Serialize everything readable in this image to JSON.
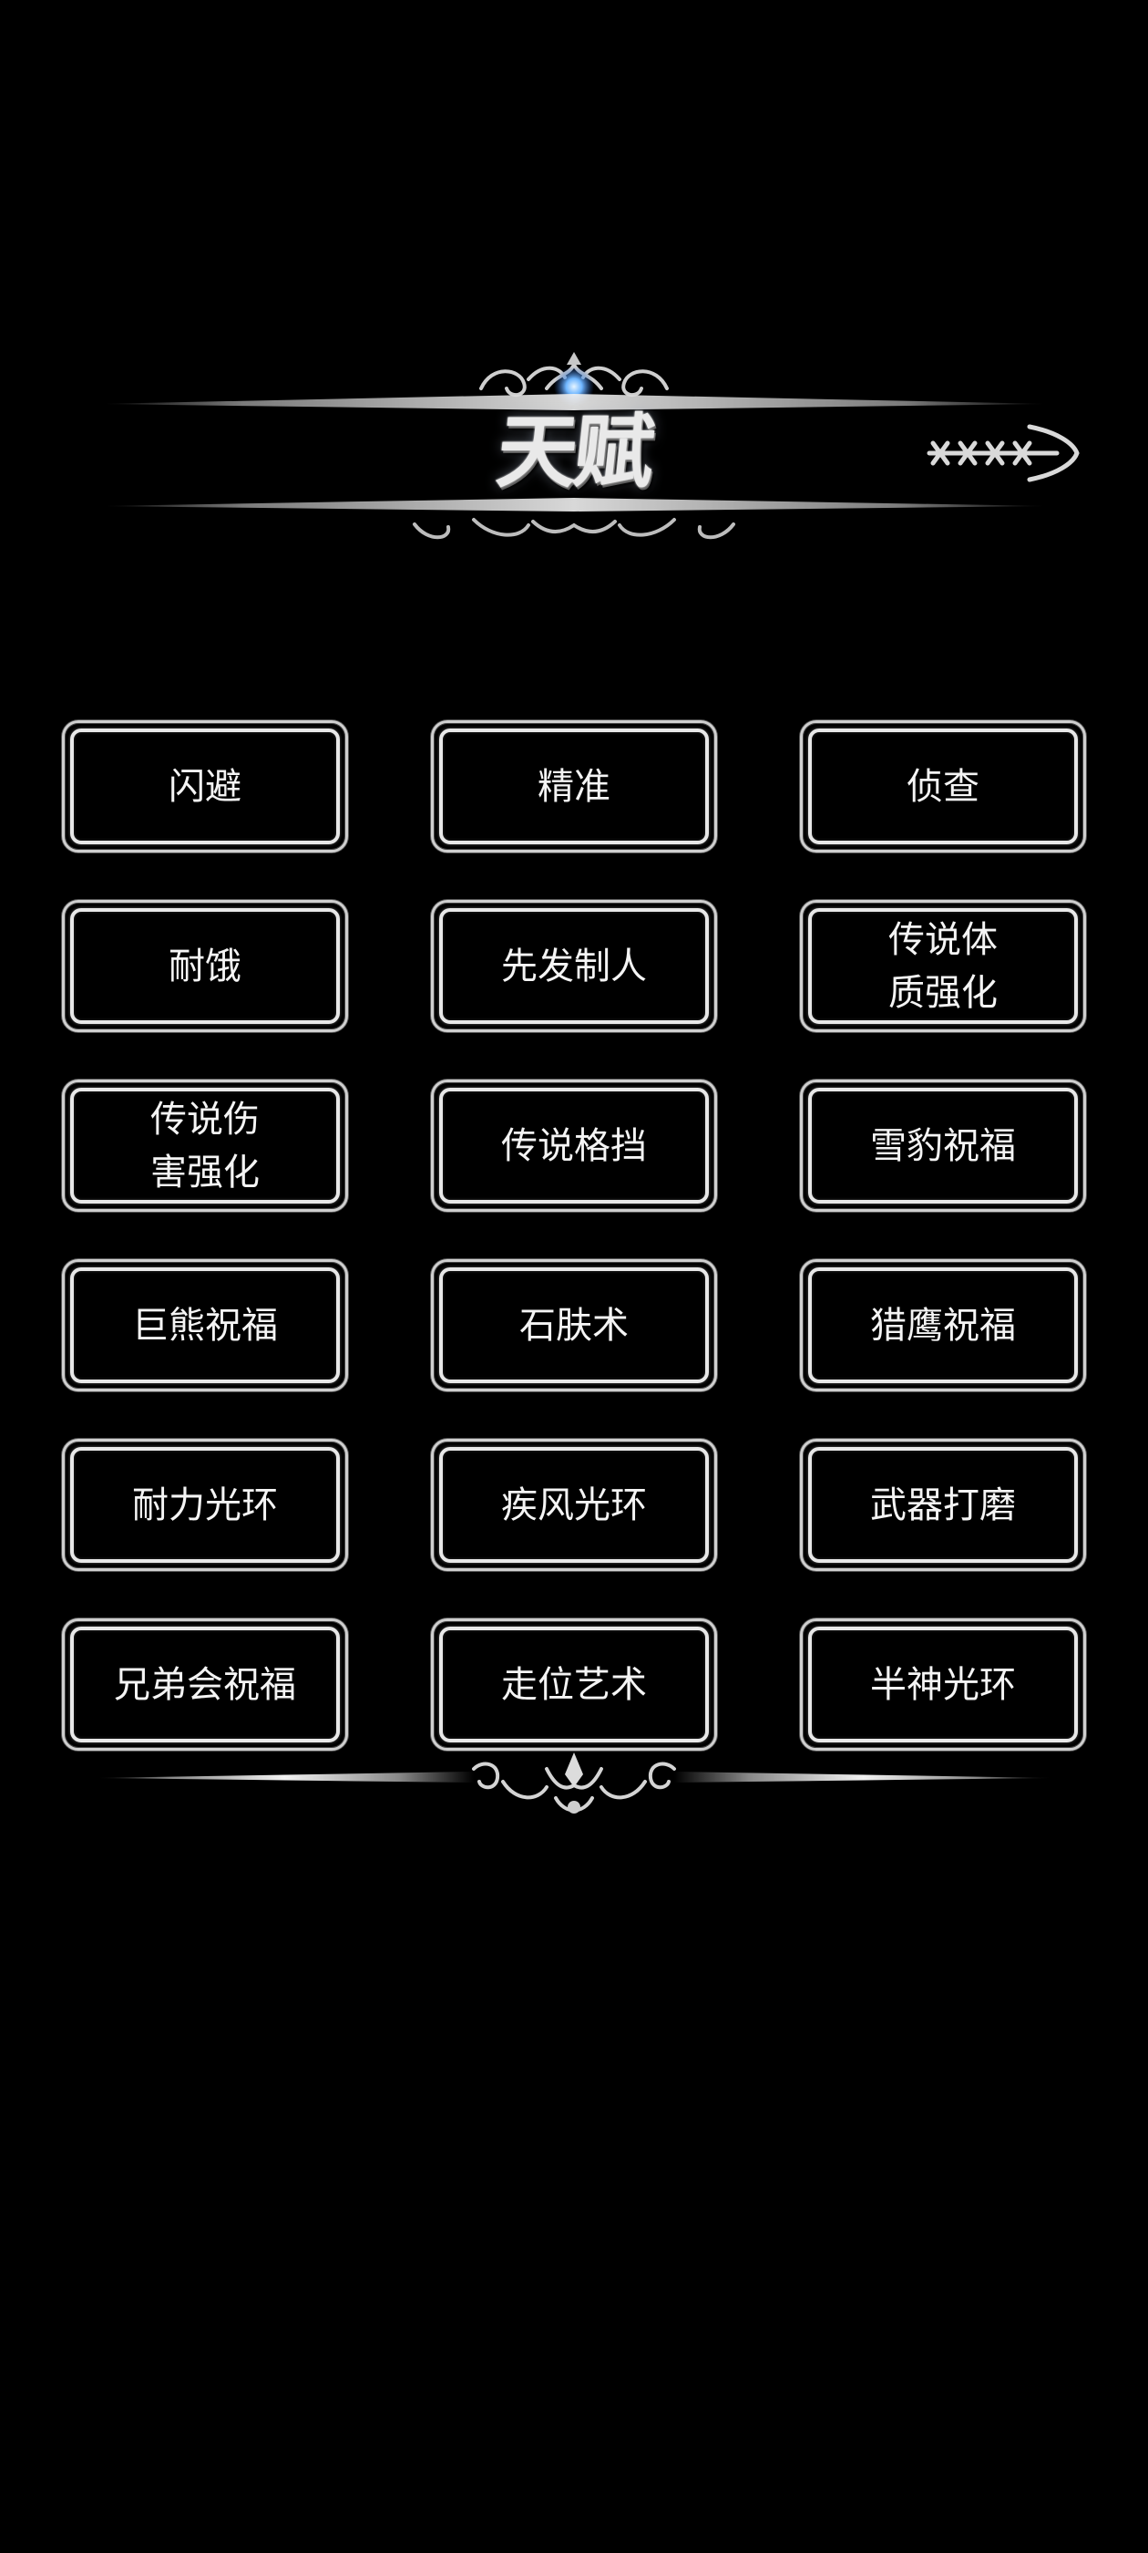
{
  "header": {
    "title": "天赋",
    "back_icon": "arrow-right-icon"
  },
  "talents": [
    {
      "label": "闪避"
    },
    {
      "label": "精准"
    },
    {
      "label": "侦查"
    },
    {
      "label": "耐饿"
    },
    {
      "label": "先发制人"
    },
    {
      "label": "传说体质强化"
    },
    {
      "label": "传说伤害强化"
    },
    {
      "label": "传说格挡"
    },
    {
      "label": "雪豹祝福"
    },
    {
      "label": "巨熊祝福"
    },
    {
      "label": "石肤术"
    },
    {
      "label": "猎鹰祝福"
    },
    {
      "label": "耐力光环"
    },
    {
      "label": "疾风光环"
    },
    {
      "label": "武器打磨"
    },
    {
      "label": "兄弟会祝福"
    },
    {
      "label": "走位艺术"
    },
    {
      "label": "半神光环"
    }
  ],
  "colors": {
    "background": "#000000",
    "frame": "#e8e8e8",
    "text": "#f4f4f4",
    "gem": "#6fb6ff"
  }
}
